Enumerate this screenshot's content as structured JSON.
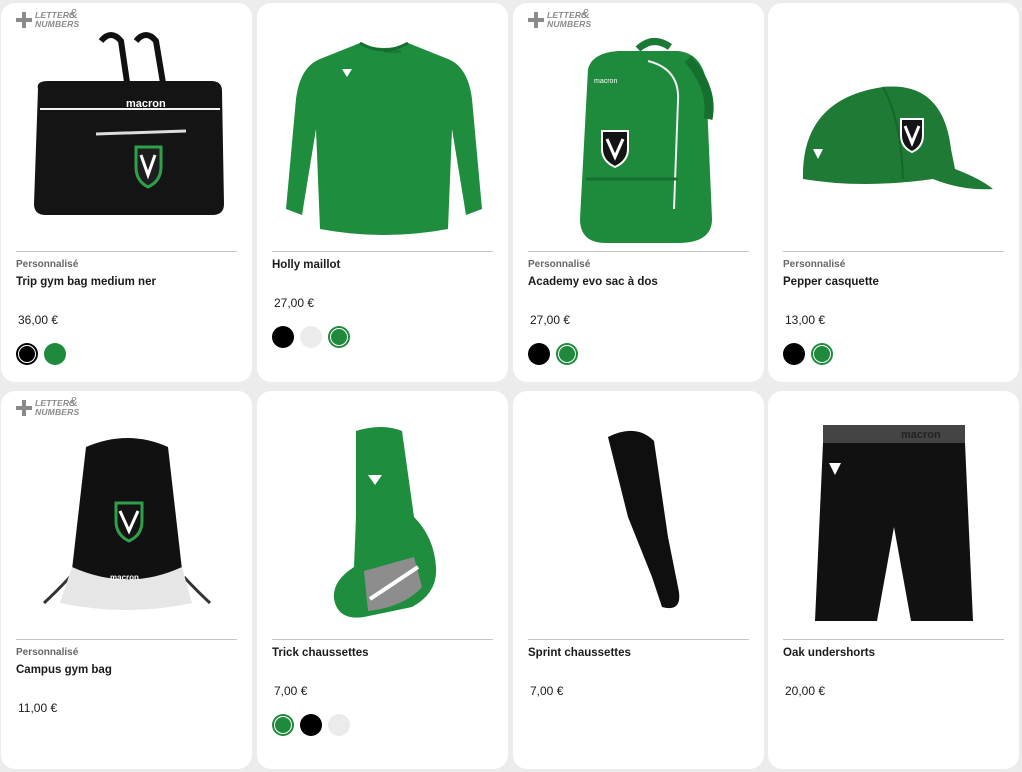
{
  "colors": {
    "black": "#000000",
    "white": "#ebebeb",
    "green": "#1f8a3c"
  },
  "badge": {
    "line1": "LETTERS",
    "line2": "NUMBERS",
    "amp": "&"
  },
  "products": [
    {
      "tag": "Personnalisé",
      "name": "Trip gym bag medium ner",
      "price": "36,00 €",
      "image": "gym-bag-black",
      "colors": [
        "black",
        "green"
      ],
      "selected_color": "black"
    },
    {
      "tag": "",
      "name": "Holly maillot",
      "price": "27,00 €",
      "image": "long-sleeve-jersey-green",
      "colors": [
        "black",
        "white",
        "green"
      ],
      "selected_color": "green"
    },
    {
      "tag": "Personnalisé",
      "name": "Academy evo sac à dos",
      "price": "27,00 €",
      "image": "backpack-green",
      "colors": [
        "black",
        "green"
      ],
      "selected_color": "green"
    },
    {
      "tag": "Personnalisé",
      "name": "Pepper casquette",
      "price": "13,00 €",
      "image": "cap-green",
      "colors": [
        "black",
        "green"
      ],
      "selected_color": "green"
    },
    {
      "tag": "Personnalisé",
      "name": "Campus gym bag",
      "price": "11,00 €",
      "image": "drawstring-bag-black",
      "colors": [],
      "selected_color": ""
    },
    {
      "tag": "",
      "name": "Trick chaussettes",
      "price": "7,00 €",
      "image": "socks-green",
      "colors": [
        "green",
        "black",
        "white"
      ],
      "selected_color": "green"
    },
    {
      "tag": "",
      "name": "Sprint chaussettes",
      "price": "7,00 €",
      "image": "leg-sleeve-black",
      "colors": [],
      "selected_color": ""
    },
    {
      "tag": "",
      "name": "Oak undershorts",
      "price": "20,00 €",
      "image": "undershorts-black",
      "colors": [],
      "selected_color": ""
    }
  ]
}
